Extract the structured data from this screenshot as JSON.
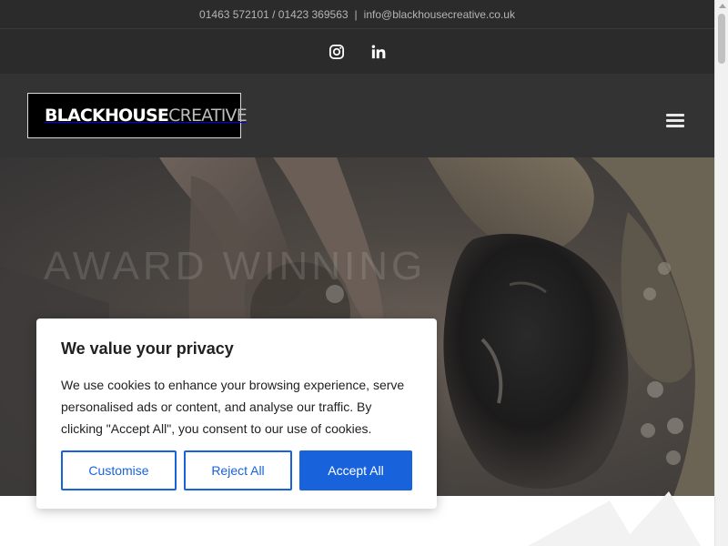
{
  "topbar": {
    "phones": "01463 572101 / 01423 369563",
    "separator": "|",
    "email": "info@blackhousecreative.co.uk"
  },
  "social": {
    "icons": [
      "instagram-icon",
      "linkedin-icon"
    ]
  },
  "header": {
    "logo_bold": "BLACKHOUSE",
    "logo_light": "CREATIVE",
    "menu_icon": "hamburger-menu-icon"
  },
  "hero": {
    "heading_partial": "AWARD WINNING"
  },
  "cookie_banner": {
    "title": "We value your privacy",
    "body": "We use cookies to enhance your browsing experience, serve personalised ads or content, and analyse our traffic. By clicking \"Accept All\", you consent to our use of cookies.",
    "customise_label": "Customise",
    "reject_label": "Reject All",
    "accept_label": "Accept All",
    "accent_color": "#1863dc"
  }
}
